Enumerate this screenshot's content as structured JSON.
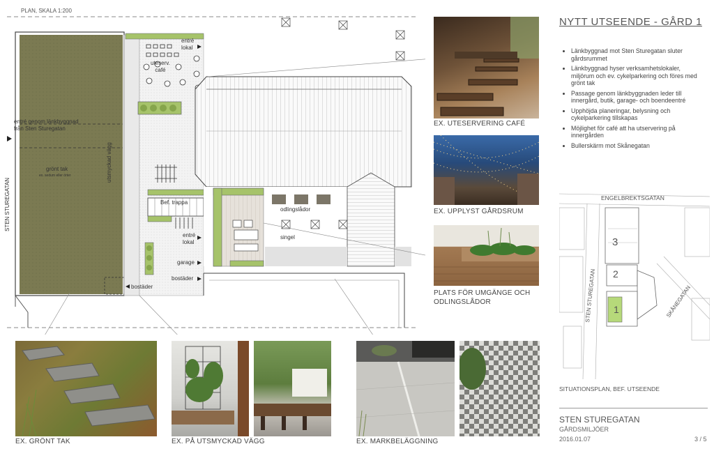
{
  "plan": {
    "scale_label": "PLAN, SKALA 1:200",
    "labels": {
      "entre_lokal_top": "entré\nlokal",
      "uteservering": "uteserv.\ncafé",
      "entre_genom": "entré genom länkbyggnad\nfrån Sten Sturegatan",
      "gront_tak": "grönt tak",
      "gront_tak_sub": "ex. sedum eller örter",
      "utsmyckad_vagg": "utsmyckad vägg",
      "bef_trappa": "Bef. trappa",
      "odlingslador": "odlingslådor",
      "singel": "singel",
      "entre_lokal_bottom": "entré\nlokal",
      "garage": "garage",
      "bostader_right": "bostäder",
      "bostader_left": "bostäder",
      "sten_sturegatan": "STEN STUREGATAN"
    }
  },
  "photos": {
    "uteservering": "EX. UTESERVERING CAFÉ",
    "upplyst": "EX. UPPLYST GÅRDSRUM",
    "umgange": "PLATS FÖR UMGÄNGE OCH\nODLINGSLÅDOR",
    "gront_tak": "EX. GRÖNT TAK",
    "utsmyckad_vagg": "EX. PÅ UTSMYCKAD VÄGG",
    "markbelaggning": "EX. MARKBELÄGGNING"
  },
  "sidebar": {
    "title": "NYTT UTSEENDE - GÅRD 1",
    "bullets": [
      "Länkbyggnad mot Sten Sturegatan sluter gårdsrummet",
      "Länkbyggnad hyser verksamhetslokaler, miljörum och ev. cykelparkering och föres med grönt tak",
      "Passage genom länkbyggnaden leder till innergård, butik, garage- och boendeentré",
      "Upphöjda planeringar, belysning och cykelparkering tillskapas",
      "Möjlighet för café att ha utservering på innergården",
      "Bullerskärm mot Skånegatan"
    ]
  },
  "situation": {
    "street_top": "ENGELBREKTSGATAN",
    "street_left": "STEN STUREGATAN",
    "street_right": "SKÅNEGATAN",
    "n3": "3",
    "n2": "2",
    "n1": "1",
    "caption": "SITUATIONSPLAN, BEF. UTSEENDE"
  },
  "footer": {
    "project": "STEN STUREGATAN",
    "subtitle": "GÅRDSMILJÖER",
    "date": "2016.01.07",
    "page": "3 / 5"
  },
  "colors": {
    "green_roof": "#7b7a52",
    "accent_green": "#a6c36a",
    "text": "#444444"
  }
}
